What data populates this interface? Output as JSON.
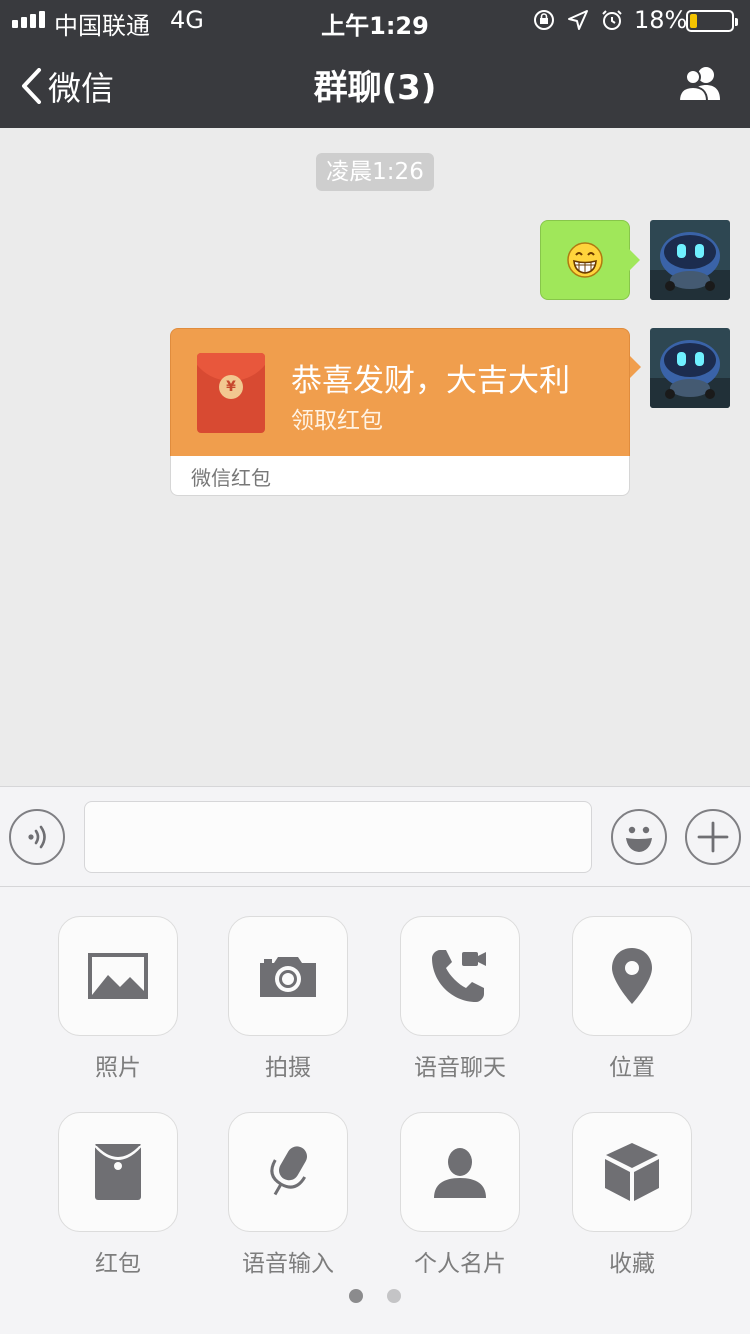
{
  "status_bar": {
    "carrier": "中国联通",
    "network": "4G",
    "time": "上午1:29",
    "battery_percent": "18%",
    "battery_level": 0.18,
    "icons": [
      "rotation-lock-icon",
      "location-arrow-icon",
      "alarm-icon"
    ]
  },
  "nav": {
    "back_label": "微信",
    "title": "群聊(3)",
    "right_icon": "group-members-icon"
  },
  "chat": {
    "timestamp": "凌晨1:26",
    "messages": [
      {
        "type": "emoji",
        "emoji": "😁",
        "sender": "self"
      },
      {
        "type": "red_packet",
        "sender": "self",
        "title": "恭喜发财，大吉大利",
        "subtitle": "领取红包",
        "footer": "微信红包",
        "coin_symbol": "¥"
      }
    ]
  },
  "input_bar": {
    "voice_icon": "voice-icon",
    "input_value": "",
    "emoji_icon": "emoji-icon",
    "plus_icon": "plus-icon"
  },
  "panel": {
    "items": [
      {
        "label": "照片",
        "icon": "photo-icon"
      },
      {
        "label": "拍摄",
        "icon": "camera-icon"
      },
      {
        "label": "语音聊天",
        "icon": "voice-call-icon"
      },
      {
        "label": "位置",
        "icon": "location-icon"
      },
      {
        "label": "红包",
        "icon": "red-packet-icon"
      },
      {
        "label": "语音输入",
        "icon": "microphone-icon"
      },
      {
        "label": "个人名片",
        "icon": "contact-card-icon"
      },
      {
        "label": "收藏",
        "icon": "favorites-box-icon"
      }
    ],
    "page_count": 2,
    "current_page": 1
  },
  "colors": {
    "nav_bg": "#393a3e",
    "chat_bg": "#ebebeb",
    "green_bubble": "#a0e75a",
    "red_packet": "#f09e4d",
    "icon_gray": "#6f6f73"
  }
}
